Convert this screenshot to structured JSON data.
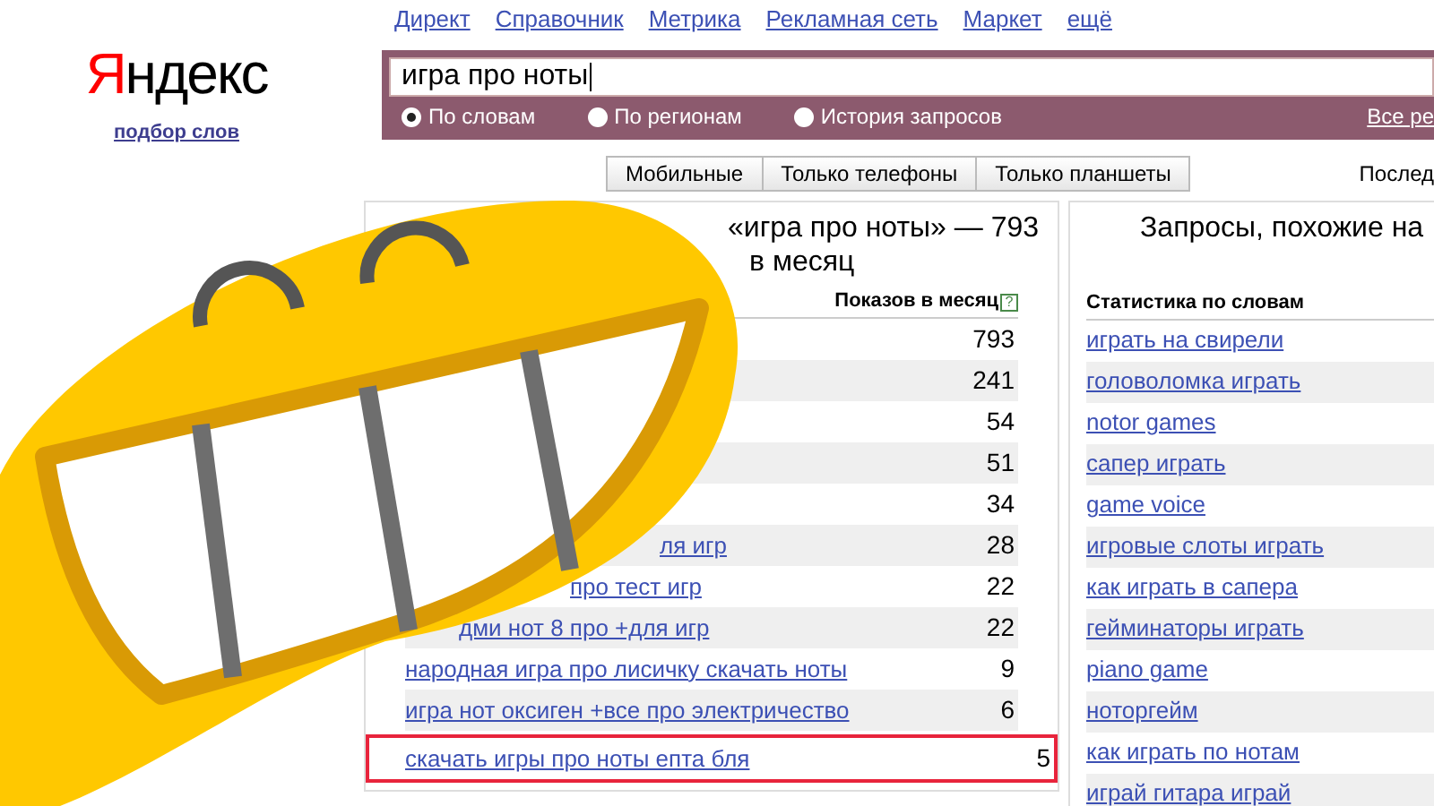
{
  "logo": {
    "first_letter": "Я",
    "rest": "ндекс"
  },
  "subtitle_link": "подбор слов",
  "nav_links": [
    "Директ",
    "Справочник",
    "Метрика",
    "Рекламная сеть",
    "Маркет",
    "ещё"
  ],
  "search": {
    "value": "игра про ноты"
  },
  "modes": [
    {
      "label": "По словам",
      "selected": true
    },
    {
      "label": "По регионам",
      "selected": false
    },
    {
      "label": "История запросов",
      "selected": false
    }
  ],
  "all_regions_link": "Все ре",
  "device_tabs": [
    "Мобильные",
    "Только телефоны",
    "Только планшеты"
  ],
  "period_label": "Послед",
  "left_panel": {
    "title_line_1": "«игра про ноты» — 793",
    "title_line_2": "в месяц",
    "column_header": "Показов в месяц",
    "help_icon": "?",
    "rows": [
      {
        "count": "793",
        "highlighted": false
      },
      {
        "count": "241",
        "highlighted": false
      },
      {
        "count": "54",
        "highlighted": false
      },
      {
        "count": "51",
        "highlighted": false
      },
      {
        "count": "34",
        "highlighted": false
      },
      {
        "keyword": "ля игр",
        "count": "28",
        "highlighted": false
      },
      {
        "keyword": "про тест игр",
        "count": "22",
        "highlighted": false
      },
      {
        "keyword": "дми нот 8 про +для игр",
        "count": "22",
        "highlighted": false
      },
      {
        "keyword": "народная игра про лисичку скачать ноты",
        "count": "9",
        "highlighted": false
      },
      {
        "keyword": "игра нот оксиген +все про электричество",
        "count": "6",
        "highlighted": false
      },
      {
        "keyword": "скачать игры про ноты епта бля",
        "count": "5",
        "highlighted": true
      }
    ]
  },
  "right_panel": {
    "title": "Запросы, похожие на",
    "column_header": "Статистика по словам",
    "rows": [
      "играть на свирели",
      "головоломка играть",
      "notor games",
      "сапер играть",
      "game voice",
      "игровые слоты играть",
      "как играть в сапера",
      "гейминаторы играть",
      "piano game",
      "ноторгейм",
      "как играть по нотам",
      "играй гитара играй"
    ]
  }
}
